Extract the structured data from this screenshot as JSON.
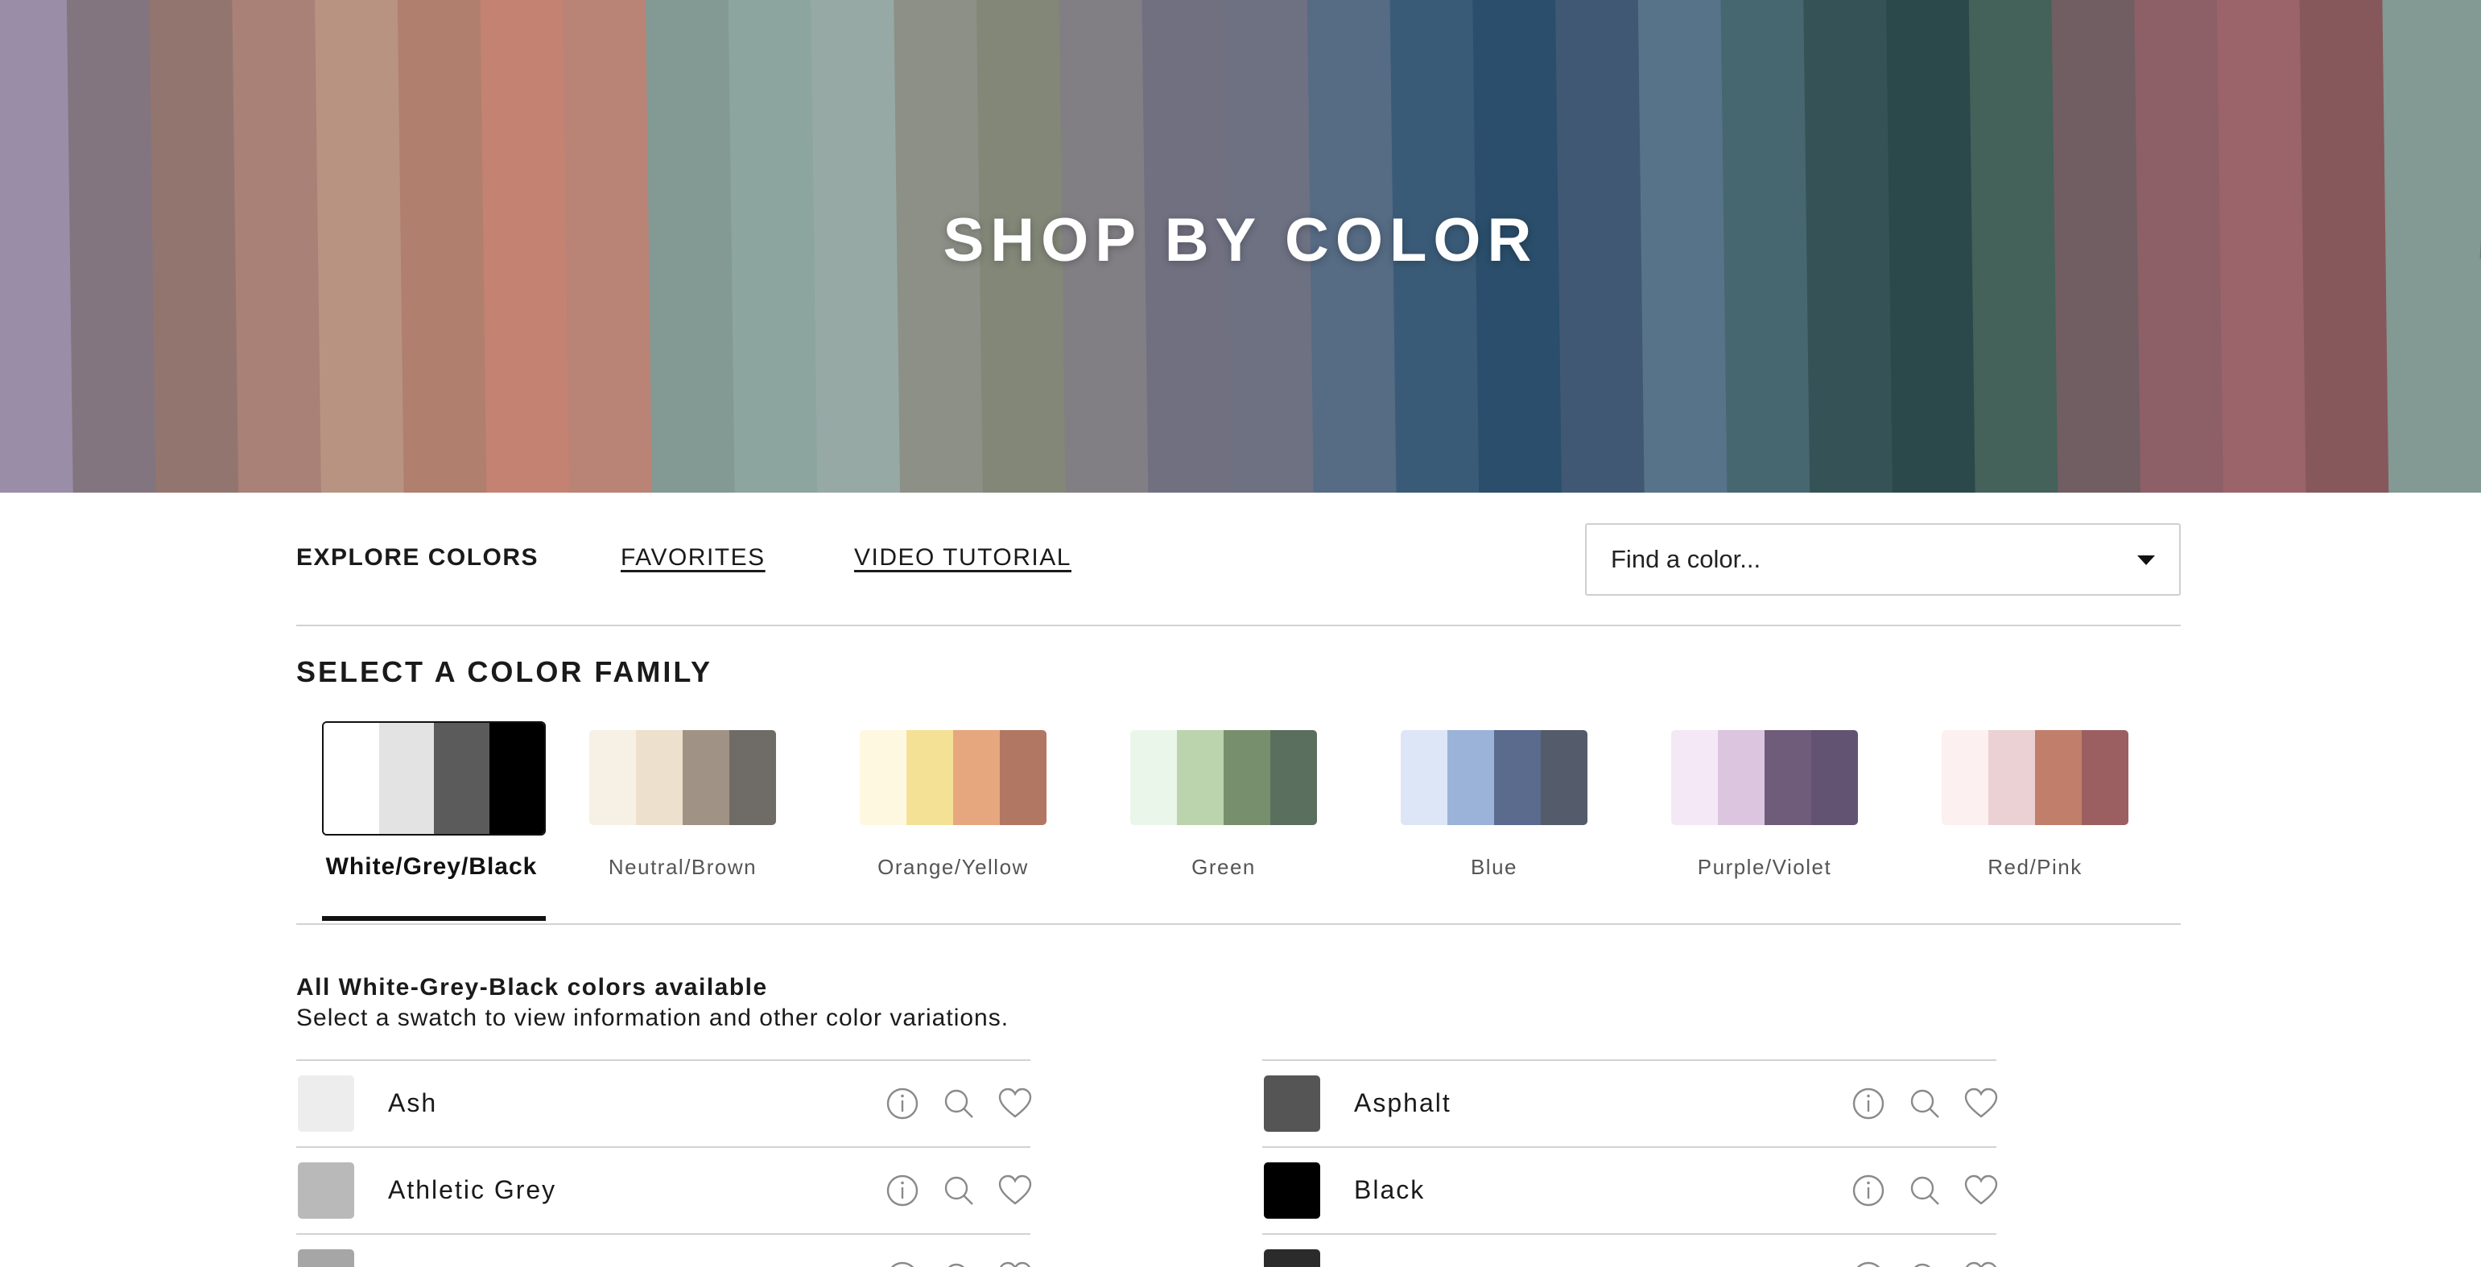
{
  "hero": {
    "title": "SHOP BY COLOR"
  },
  "nav": {
    "explore_label": "EXPLORE COLORS",
    "favorites_label": "FAVORITES",
    "video_label": "VIDEO TUTORIAL",
    "search": {
      "placeholder": "Find a color...",
      "icon": "chevron-down-icon"
    }
  },
  "families": {
    "title": "SELECT A COLOR FAMILY",
    "items": [
      {
        "label": "White/Grey/Black",
        "active": true,
        "colors": [
          "#ffffff",
          "#e3e3e3",
          "#5b5b5b",
          "#000000"
        ]
      },
      {
        "label": "Neutral/Brown",
        "active": false,
        "colors": [
          "#f7f0e4",
          "#ede0cc",
          "#a09284",
          "#6f6c68"
        ]
      },
      {
        "label": "Orange/Yellow",
        "active": false,
        "colors": [
          "#fff8e1",
          "#f4e196",
          "#e6a77f",
          "#b27763"
        ]
      },
      {
        "label": "Green",
        "active": false,
        "colors": [
          "#ebf6ea",
          "#bcd4ae",
          "#778f6d",
          "#5b6f5e"
        ]
      },
      {
        "label": "Blue",
        "active": false,
        "colors": [
          "#dce6f7",
          "#9bb3d8",
          "#5b6b8d",
          "#545b6b"
        ]
      },
      {
        "label": "Purple/Violet",
        "active": false,
        "colors": [
          "#f5e8f6",
          "#dbc5df",
          "#6f5c7a",
          "#625373"
        ]
      },
      {
        "label": "Red/Pink",
        "active": false,
        "colors": [
          "#fdf0f0",
          "#ecd1d4",
          "#c17e6b",
          "#9c5f61"
        ]
      }
    ]
  },
  "results": {
    "title": "All White-Grey-Black colors available",
    "subtitle": "Select a swatch to view information and other color variations.",
    "left": [
      {
        "name": "Ash",
        "swatch": "#ededed"
      },
      {
        "name": "Athletic Grey",
        "swatch": "#b9b9b9"
      },
      {
        "name": "",
        "swatch": "#a6a6a6"
      }
    ],
    "right": [
      {
        "name": "Asphalt",
        "swatch": "#555555"
      },
      {
        "name": "Black",
        "swatch": "#000000"
      },
      {
        "name": "",
        "swatch": "#2b2b2b"
      }
    ],
    "icons": [
      "info-icon",
      "search-icon",
      "heart-icon"
    ]
  },
  "colors": {
    "text": "#1a1a1a",
    "rule": "#d2d2d2",
    "active_underline": "#111111"
  }
}
